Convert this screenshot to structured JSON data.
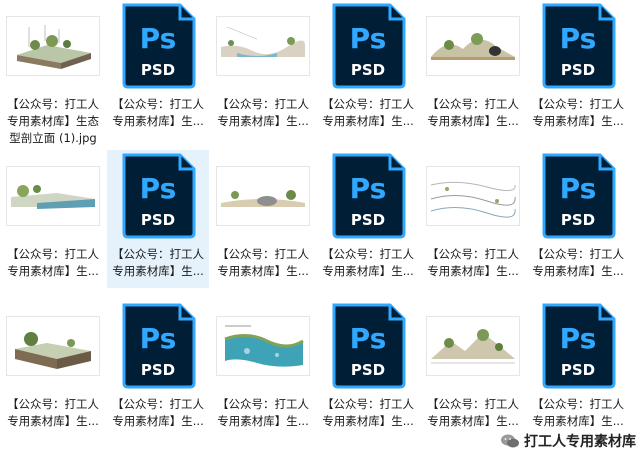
{
  "files": [
    {
      "kind": "image",
      "label_1": "【公众号：打工人",
      "label_2": "专用素材库】生态",
      "label_3": "型剖立面 (1).jpg"
    },
    {
      "kind": "psd",
      "label_1": "【公众号：打工人",
      "label_2": "专用素材库】生...",
      "label_3": "",
      "icon_text_top": "Ps",
      "icon_text_bottom": "PSD"
    },
    {
      "kind": "image",
      "label_1": "【公众号：打工人",
      "label_2": "专用素材库】生...",
      "label_3": ""
    },
    {
      "kind": "psd",
      "label_1": "【公众号：打工人",
      "label_2": "专用素材库】生...",
      "label_3": "",
      "icon_text_top": "Ps",
      "icon_text_bottom": "PSD"
    },
    {
      "kind": "image",
      "label_1": "【公众号：打工人",
      "label_2": "专用素材库】生...",
      "label_3": ""
    },
    {
      "kind": "psd",
      "label_1": "【公众号：打工人",
      "label_2": "专用素材库】生...",
      "label_3": "",
      "icon_text_top": "Ps",
      "icon_text_bottom": "PSD"
    },
    {
      "kind": "image",
      "label_1": "【公众号：打工人",
      "label_2": "专用素材库】生...",
      "label_3": ""
    },
    {
      "kind": "psd",
      "label_1": "【公众号：打工人",
      "label_2": "专用素材库】生...",
      "label_3": "",
      "icon_text_top": "Ps",
      "icon_text_bottom": "PSD",
      "selected": true
    },
    {
      "kind": "image",
      "label_1": "【公众号：打工人",
      "label_2": "专用素材库】生...",
      "label_3": ""
    },
    {
      "kind": "psd",
      "label_1": "【公众号：打工人",
      "label_2": "专用素材库】生...",
      "label_3": "",
      "icon_text_top": "Ps",
      "icon_text_bottom": "PSD"
    },
    {
      "kind": "image",
      "label_1": "【公众号：打工人",
      "label_2": "专用素材库】生...",
      "label_3": ""
    },
    {
      "kind": "psd",
      "label_1": "【公众号：打工人",
      "label_2": "专用素材库】生...",
      "label_3": "",
      "icon_text_top": "Ps",
      "icon_text_bottom": "PSD"
    },
    {
      "kind": "image",
      "label_1": "【公众号：打工人",
      "label_2": "专用素材库】生...",
      "label_3": ""
    },
    {
      "kind": "psd",
      "label_1": "【公众号：打工人",
      "label_2": "专用素材库】生...",
      "label_3": "",
      "icon_text_top": "Ps",
      "icon_text_bottom": "PSD"
    },
    {
      "kind": "image",
      "label_1": "【公众号：打工人",
      "label_2": "专用素材库】生...",
      "label_3": ""
    },
    {
      "kind": "psd",
      "label_1": "【公众号：打工人",
      "label_2": "专用素材库】生...",
      "label_3": "",
      "icon_text_top": "Ps",
      "icon_text_bottom": "PSD"
    },
    {
      "kind": "image",
      "label_1": "【公众号：打工人",
      "label_2": "专用素材库】生...",
      "label_3": ""
    },
    {
      "kind": "psd",
      "label_1": "【公众号：打工人",
      "label_2": "专用素材库】生...",
      "label_3": "",
      "icon_text_top": "Ps",
      "icon_text_bottom": "PSD"
    }
  ],
  "watermark": {
    "text": "打工人专用素材库",
    "icon": "wechat-icon"
  },
  "colors": {
    "ps_bg": "#001e36",
    "ps_accent": "#31a8ff",
    "selection": "#e5f1fb"
  }
}
